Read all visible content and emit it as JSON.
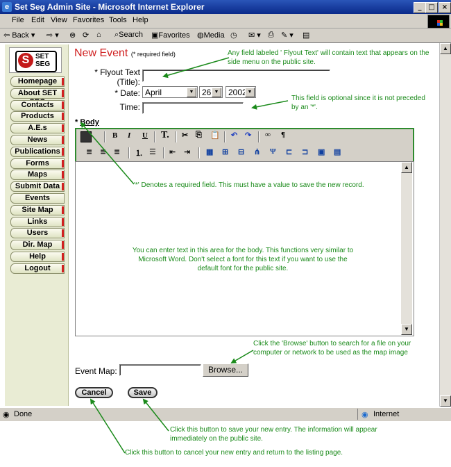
{
  "window": {
    "title": "Set Seg Admin Site - Microsoft Internet Explorer",
    "controls": [
      "_",
      "□",
      "×"
    ]
  },
  "menubar": [
    "File",
    "Edit",
    "View",
    "Favorites",
    "Tools",
    "Help"
  ],
  "toolbar": {
    "back": "Back",
    "search": "Search",
    "favorites": "Favorites",
    "media": "Media"
  },
  "sidebar": {
    "logo_text_1": "SET",
    "logo_text_2": "SEG",
    "logo_letter": "S",
    "items": [
      "Homepage",
      "About SET SEG",
      "Contacts",
      "Products",
      "A.E.s",
      "News",
      "Publications",
      "Forms",
      "Maps",
      "Submit Data",
      "Events",
      "Site Map",
      "Links",
      "Users",
      "Dir. Map",
      "Help",
      "Logout"
    ]
  },
  "form": {
    "heading": "New Event",
    "required_note": "(* required field)",
    "flyout_label_1": "* Flyout Text",
    "flyout_label_2": "(Title):",
    "flyout_value": "",
    "date_label": "* Date:",
    "month": "April",
    "day": "26",
    "year": "2002",
    "time_label": "Time:",
    "time_value": "",
    "body_label_star": "*",
    "body_label": "Body",
    "event_map_label": "Event Map:",
    "browse_label": "Browse...",
    "cancel_label": "Cancel",
    "save_label": "Save"
  },
  "editor_toolbar": {
    "bold": "B",
    "italic": "I",
    "underline": "U",
    "font": "T.",
    "paragraph": "¶"
  },
  "notes": {
    "flyout": "Any field labeled ' Flyout Text' will contain text that appears on the side menu on the public site.",
    "optional": "This field is optional since it is not preceded by an '*'.",
    "required": "'*' Denotes a required field. This must have a value to save the new record.",
    "body": "You can enter text in this area for the body. This functions very similar to Microsoft Word. Don't select a font for this text if you want to use the default font for the public site.",
    "browse": "Click the 'Browse' button to search for a file on your computer or network to be used as the map image",
    "save": "Click this button to save your new entry. The information will appear immediately on the public site.",
    "cancel": "Click this button to cancel your new entry and return to the listing page."
  },
  "statusbar": {
    "left": "Done",
    "zone": "Internet"
  },
  "colors": {
    "titlebar": "#0a2a8a",
    "heading": "#d02020",
    "annotation": "#1a8a1a",
    "sidebar": "#e9ecd4"
  }
}
